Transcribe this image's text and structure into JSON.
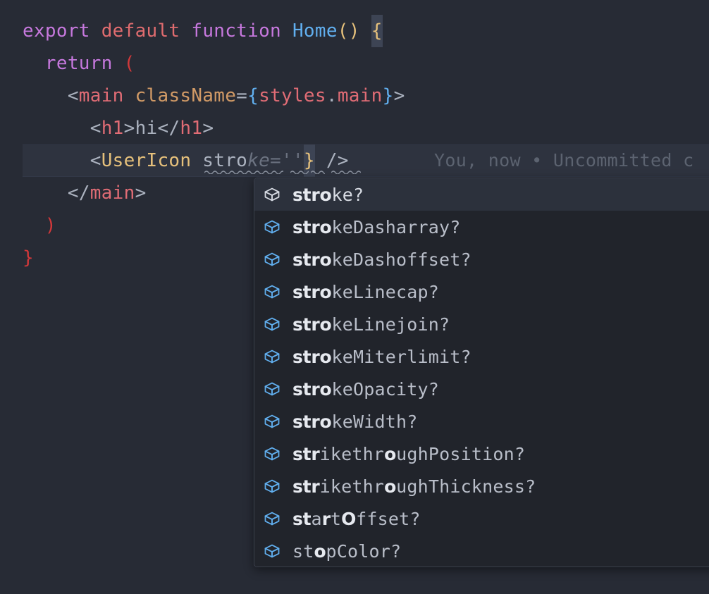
{
  "theme": {
    "editor_bg": "#272b35",
    "active_line_bg": "#2e333f",
    "popup_bg": "#21242b",
    "popup_border": "#3a3f4b",
    "selected_row_bg": "#2c313c",
    "icon_blue": "#61afef",
    "icon_white": "#d7dbe3",
    "text_default": "#abb2bf",
    "ghost_text": "#6b7280",
    "blame_text": "#5c6370"
  },
  "editor": {
    "language": "tsx",
    "lines": [
      {
        "n": 1,
        "tokens": [
          {
            "t": "export",
            "c": "kw"
          },
          {
            "t": " ",
            "c": "plain"
          },
          {
            "t": "default",
            "c": "kw2"
          },
          {
            "t": " ",
            "c": "plain"
          },
          {
            "t": "function",
            "c": "kw"
          },
          {
            "t": " ",
            "c": "plain"
          },
          {
            "t": "Home",
            "c": "fnname"
          },
          {
            "t": "()",
            "c": "paren"
          },
          {
            "t": " ",
            "c": "plain"
          },
          {
            "t": "{",
            "c": "brace-match-token"
          }
        ]
      },
      {
        "n": 2,
        "tokens": [
          {
            "t": "  ",
            "c": "plain"
          },
          {
            "t": "return",
            "c": "kw"
          },
          {
            "t": " ",
            "c": "plain"
          },
          {
            "t": "(",
            "c": "redparen"
          }
        ]
      },
      {
        "n": 3,
        "tokens": [
          {
            "t": "    <",
            "c": "punct"
          },
          {
            "t": "main",
            "c": "tag"
          },
          {
            "t": " ",
            "c": "plain"
          },
          {
            "t": "className",
            "c": "attr"
          },
          {
            "t": "=",
            "c": "punct"
          },
          {
            "t": "{",
            "c": "blue"
          },
          {
            "t": "styles",
            "c": "prop"
          },
          {
            "t": ".",
            "c": "punct"
          },
          {
            "t": "main",
            "c": "prop"
          },
          {
            "t": "}",
            "c": "blue"
          },
          {
            "t": ">",
            "c": "punct"
          }
        ]
      },
      {
        "n": 4,
        "tokens": [
          {
            "t": "      <",
            "c": "punct"
          },
          {
            "t": "h1",
            "c": "tag"
          },
          {
            "t": ">",
            "c": "punct"
          },
          {
            "t": "hi",
            "c": "plain"
          },
          {
            "t": "</",
            "c": "punct"
          },
          {
            "t": "h1",
            "c": "tag"
          },
          {
            "t": ">",
            "c": "punct"
          }
        ]
      },
      {
        "n": 5,
        "active": true,
        "tokens": [
          {
            "t": "      <",
            "c": "punct"
          },
          {
            "t": "UserIcon",
            "c": "comp"
          },
          {
            "t": " ",
            "c": "plain"
          },
          {
            "t": "stro",
            "c": "typed"
          },
          {
            "t": "ke=''",
            "c": "ghost"
          },
          {
            "t": "}",
            "c": "cursor-token"
          },
          {
            "t": " />",
            "c": "punct"
          }
        ]
      },
      {
        "n": 6,
        "tokens": [
          {
            "t": "    </",
            "c": "punct"
          },
          {
            "t": "main",
            "c": "tag"
          },
          {
            "t": ">",
            "c": "punct"
          }
        ]
      },
      {
        "n": 7,
        "tokens": [
          {
            "t": "  ",
            "c": "plain"
          },
          {
            "t": ")",
            "c": "redparen"
          }
        ]
      },
      {
        "n": 8,
        "tokens": [
          {
            "t": "}",
            "c": "redparen"
          }
        ]
      }
    ]
  },
  "blame": {
    "text": "You, now • Uncommitted c"
  },
  "suggest": {
    "icon_name": "property-cube-icon",
    "items": [
      {
        "label": "stroke?",
        "segments": [
          {
            "t": "stro",
            "hl": true
          },
          {
            "t": "ke?",
            "hl": false
          }
        ],
        "selected": true
      },
      {
        "label": "strokeDasharray?",
        "segments": [
          {
            "t": "stro",
            "hl": true
          },
          {
            "t": "keDasharray?",
            "hl": false
          }
        ],
        "selected": false
      },
      {
        "label": "strokeDashoffset?",
        "segments": [
          {
            "t": "stro",
            "hl": true
          },
          {
            "t": "keDashoffset?",
            "hl": false
          }
        ],
        "selected": false
      },
      {
        "label": "strokeLinecap?",
        "segments": [
          {
            "t": "stro",
            "hl": true
          },
          {
            "t": "keLinecap?",
            "hl": false
          }
        ],
        "selected": false
      },
      {
        "label": "strokeLinejoin?",
        "segments": [
          {
            "t": "stro",
            "hl": true
          },
          {
            "t": "keLinejoin?",
            "hl": false
          }
        ],
        "selected": false
      },
      {
        "label": "strokeMiterlimit?",
        "segments": [
          {
            "t": "stro",
            "hl": true
          },
          {
            "t": "keMiterlimit?",
            "hl": false
          }
        ],
        "selected": false
      },
      {
        "label": "strokeOpacity?",
        "segments": [
          {
            "t": "stro",
            "hl": true
          },
          {
            "t": "keOpacity?",
            "hl": false
          }
        ],
        "selected": false
      },
      {
        "label": "strokeWidth?",
        "segments": [
          {
            "t": "stro",
            "hl": true
          },
          {
            "t": "keWidth?",
            "hl": false
          }
        ],
        "selected": false
      },
      {
        "label": "strikethroughPosition?",
        "segments": [
          {
            "t": "str",
            "hl": true
          },
          {
            "t": "ikethr",
            "hl": false
          },
          {
            "t": "o",
            "hl": true
          },
          {
            "t": "ughPosition?",
            "hl": false
          }
        ],
        "selected": false
      },
      {
        "label": "strikethroughThickness?",
        "segments": [
          {
            "t": "str",
            "hl": true
          },
          {
            "t": "ikethr",
            "hl": false
          },
          {
            "t": "o",
            "hl": true
          },
          {
            "t": "ughThickness?",
            "hl": false
          }
        ],
        "selected": false
      },
      {
        "label": "startOffset?",
        "segments": [
          {
            "t": "st",
            "hl": true
          },
          {
            "t": "a",
            "hl": false
          },
          {
            "t": "r",
            "hl": true
          },
          {
            "t": "t",
            "hl": false
          },
          {
            "t": "O",
            "hl": true
          },
          {
            "t": "ffset?",
            "hl": false
          }
        ],
        "selected": false
      },
      {
        "label": "stopColor?",
        "segments": [
          {
            "t": "st",
            "hl": false
          },
          {
            "t": "o",
            "hl": true
          },
          {
            "t": "pColor?",
            "hl": false
          }
        ],
        "selected": false
      }
    ]
  }
}
